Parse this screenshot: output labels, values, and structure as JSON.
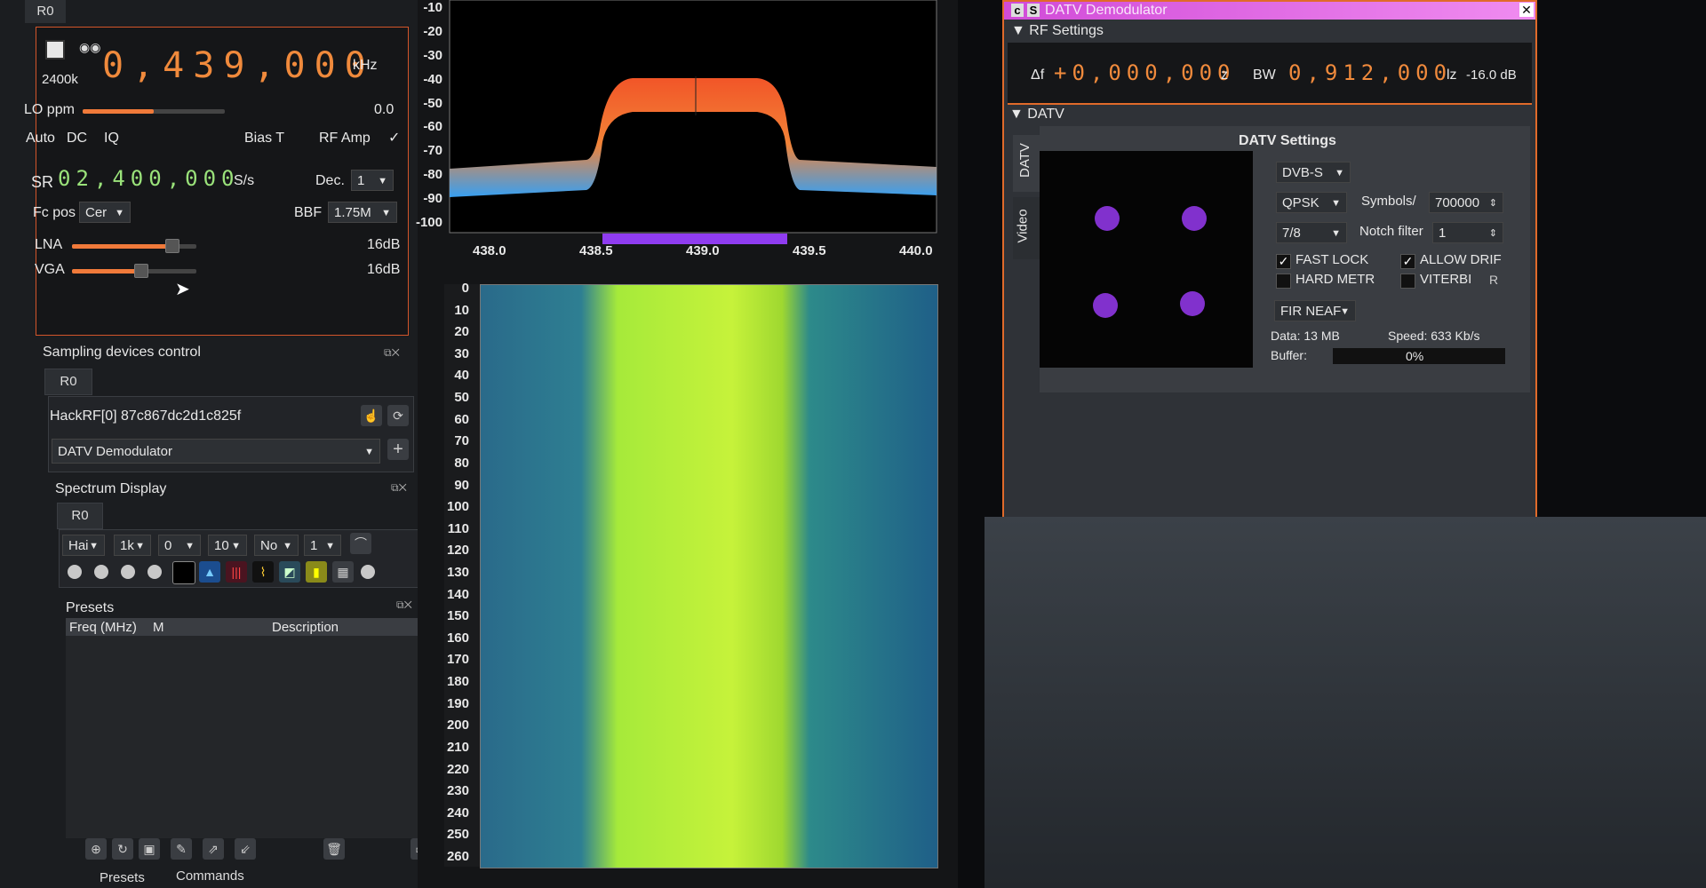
{
  "device": {
    "tab": "R0",
    "rate": "2400k",
    "frequency": "0,439,000",
    "freq_unit": "kHz",
    "lo_label": "LO ppm",
    "lo_value": "0.0",
    "auto": "Auto",
    "dc": "DC",
    "iq": "IQ",
    "bias_t": "Bias T",
    "rf_amp": "RF Amp",
    "sr_label": "SR",
    "sr_value": "02,400,000",
    "sr_unit": "S/s",
    "dec_label": "Dec.",
    "dec_value": "1",
    "fcpos_label": "Fc pos",
    "fcpos_value": "Cer",
    "bbf_label": "BBF",
    "bbf_value": "1.75M",
    "lna_label": "LNA",
    "lna_value": "16dB",
    "vga_label": "VGA",
    "vga_value": "16dB",
    "lo_level": 0.5,
    "lna_level": 0.8,
    "vga_level": 0.55
  },
  "sampling": {
    "title": "Sampling devices control",
    "tab": "R0",
    "device_name": "HackRF[0] 87c867dc2d1c825f",
    "channel": "DATV Demodulator"
  },
  "spectrum_display": {
    "title": "Spectrum Display",
    "tab": "R0",
    "window": "Hai",
    "fft": "1k",
    "ref": "0",
    "range": "10",
    "avg_mode": "No",
    "avg": "1"
  },
  "presets": {
    "title": "Presets",
    "col_freq": "Freq (MHz)",
    "col_m": "M",
    "col_desc": "Description"
  },
  "bottom_tabs": [
    "Presets",
    "Commands"
  ],
  "spectrum": {
    "y_ticks": [
      "-10",
      "-20",
      "-30",
      "-40",
      "-50",
      "-60",
      "-70",
      "-80",
      "-90",
      "-100"
    ],
    "x_ticks": [
      "438.0",
      "438.5",
      "439.0",
      "439.5",
      "440.0"
    ],
    "waterfall_ticks": [
      "0",
      "10",
      "20",
      "30",
      "40",
      "50",
      "60",
      "70",
      "80",
      "90",
      "100",
      "110",
      "120",
      "130",
      "140",
      "150",
      "160",
      "170",
      "180",
      "190",
      "200",
      "210",
      "220",
      "230",
      "240",
      "250",
      "260"
    ]
  },
  "datv": {
    "title": "DATV Demodulator",
    "rf_section": "RF Settings",
    "delta_f_label": "Δf",
    "delta_f": "+0,000,000",
    "delta_f_unit": "z",
    "bw_label": "BW",
    "bw_value": "0,912,000",
    "bw_unit": "lz",
    "level": "-16.0 dB",
    "datv_section": "DATV",
    "side_tab_datv": "DATV",
    "side_tab_video": "Video",
    "settings_title": "DATV Settings",
    "standard": "DVB-S",
    "modulation": "QPSK",
    "symbols_label": "Symbols/",
    "symbols_value": "700000",
    "fec": "7/8",
    "notch_label": "Notch filter",
    "notch_value": "1",
    "fast_lock": "FAST LOCK",
    "allow_drift": "ALLOW DRIF",
    "hard_metric": "HARD METR",
    "viterbi": "VITERBI",
    "r_button": "R",
    "filter": "FIR NEAF",
    "data_label": "Data: 13 MB",
    "speed_label": "Speed: 633 Kb/s",
    "buffer_label": "Buffer:",
    "buffer_value": "0%"
  },
  "colors": {
    "accent": "#e06a2a",
    "lcd_orange": "#f08a3c",
    "lcd_green": "#9ae27a",
    "title_magenta": "#d14bd8"
  }
}
